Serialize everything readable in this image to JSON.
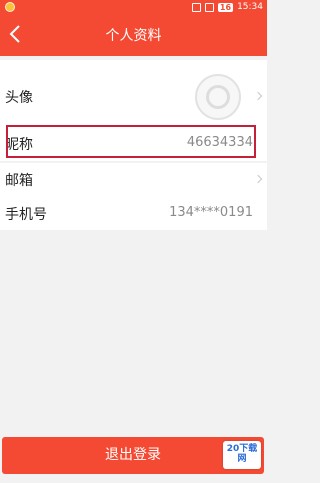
{
  "statusbar": {
    "battery": "16",
    "time": "15:34"
  },
  "header": {
    "title": "个人资料"
  },
  "profile": {
    "avatar_label": "头像",
    "nickname_label": "昵称",
    "nickname_value": "46634334",
    "email_label": "邮箱",
    "phone_label": "手机号",
    "phone_value": "134****0191"
  },
  "footer": {
    "logout_label": "退出登录"
  },
  "watermark": {
    "brand": "20下载网"
  },
  "colors": {
    "accent": "#f44a33",
    "highlight_border": "#c4203a"
  }
}
